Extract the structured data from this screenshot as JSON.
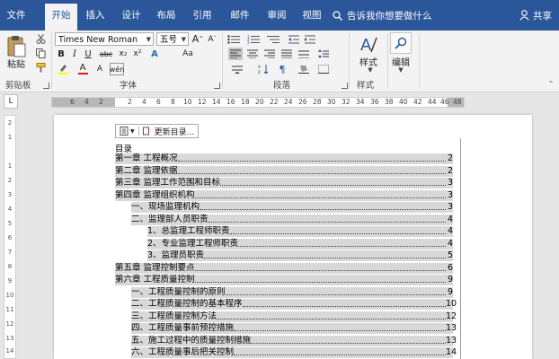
{
  "tabs": [
    {
      "label": "文件",
      "active": false
    },
    {
      "label": "开始",
      "active": true
    },
    {
      "label": "插入",
      "active": false
    },
    {
      "label": "设计",
      "active": false
    },
    {
      "label": "布局",
      "active": false
    },
    {
      "label": "引用",
      "active": false
    },
    {
      "label": "邮件",
      "active": false
    },
    {
      "label": "审阅",
      "active": false
    },
    {
      "label": "视图",
      "active": false
    }
  ],
  "tell_me": "告诉我你想要做什么",
  "share": "共享",
  "colors": {
    "tab_bar": "#2b579a",
    "ribbon": "#f3f3f3",
    "toc_highlight": "#d8d8d8",
    "font_color_underline": "#e81123",
    "highlight_underline": "#ffff00"
  },
  "ribbon": {
    "clipboard": {
      "paste_label": "粘贴",
      "group_label": "剪贴板"
    },
    "font": {
      "font_name": "Times New Roman",
      "font_size": "五号",
      "group_label": "字体",
      "buttons": [
        "B",
        "I",
        "U",
        "abc",
        "x₂",
        "x²",
        "A",
        "Aa",
        "A",
        "A",
        "wén"
      ]
    },
    "paragraph": {
      "group_label": "段落"
    },
    "styles": {
      "label": "样式",
      "group_label": "样式"
    },
    "editing": {
      "label": "编辑"
    }
  },
  "ruler": {
    "numbers": [
      "6",
      "4",
      "2",
      "2",
      "4",
      "6",
      "8",
      "10",
      "12",
      "14",
      "16",
      "18",
      "20",
      "22",
      "24",
      "26",
      "28",
      "30",
      "32",
      "34",
      "36",
      "38",
      "40",
      "42",
      "44",
      "46",
      "48"
    ],
    "corner_glyph": "L"
  },
  "vruler": {
    "numbers": [
      "2",
      "1",
      "1",
      "2",
      "3",
      "4",
      "5",
      "6",
      "7",
      "8",
      "9",
      "10",
      "11",
      "12",
      "13",
      "14"
    ]
  },
  "toc_toolbar": {
    "update_label": "更新目录..."
  },
  "toc": {
    "title": "目录",
    "entries": [
      {
        "text": "第一章   工程概况",
        "page": "2",
        "level": 1
      },
      {
        "text": "第二章   监理依据",
        "page": "2",
        "level": 1
      },
      {
        "text": "第三章   监理工作范围和目标",
        "page": "3",
        "level": 1
      },
      {
        "text": "第四章   监理组织机构",
        "page": "3",
        "level": 1
      },
      {
        "text": "一、现场监理机构",
        "page": "3",
        "level": 2
      },
      {
        "text": "二、监理部人员职责",
        "page": "4",
        "level": 2
      },
      {
        "text": "1、总监理工程师职责",
        "page": "4",
        "level": 3
      },
      {
        "text": "2、专业监理工程师职责",
        "page": "4",
        "level": 3
      },
      {
        "text": "3、监理员职责",
        "page": "5",
        "level": 3
      },
      {
        "text": "第五章   监理控制要点",
        "page": "6",
        "level": 1
      },
      {
        "text": "第六章   工程质量控制",
        "page": "9",
        "level": 1
      },
      {
        "text": "一、工程质量控制的原则",
        "page": "9",
        "level": 2
      },
      {
        "text": "二、工程质量控制的基本程序",
        "page": "10",
        "level": 2
      },
      {
        "text": "三、工程质量控制方法",
        "page": "12",
        "level": 2
      },
      {
        "text": "四、工程质量事前预控措施",
        "page": "13",
        "level": 2
      },
      {
        "text": "五、施工过程中的质量控制措施",
        "page": "13",
        "level": 2
      },
      {
        "text": "六、工程质量事后把关控制",
        "page": "14",
        "level": 2
      }
    ]
  }
}
